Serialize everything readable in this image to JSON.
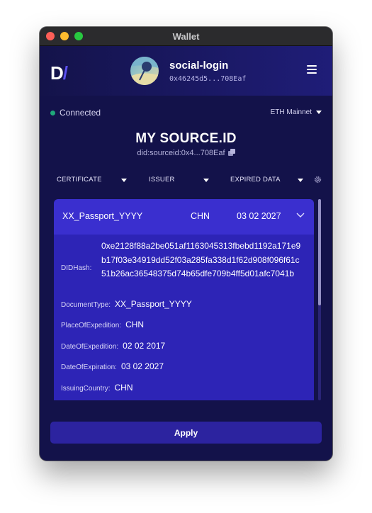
{
  "window": {
    "title": "Wallet"
  },
  "header": {
    "logo_text": "D",
    "account_name": "social-login",
    "account_address": "0x46245d5...708Eaf"
  },
  "status": {
    "connection": "Connected",
    "connection_color": "#1fa87a",
    "network": "ETH Mainnet"
  },
  "source": {
    "title": "MY SOURCE.ID",
    "did": "did:sourceid:0x4...708Eaf"
  },
  "filters": {
    "certificate": "CERTIFICATE",
    "issuer": "ISSUER",
    "expired": "EXPIRED DATA"
  },
  "card": {
    "name": "XX_Passport_YYYY",
    "country": "CHN",
    "expiry": "03 02 2027",
    "fields": {
      "did_hash_label": "DIDHash:",
      "did_hash_value": "0xe2128f88a2be051af1163045313fbebd1192a171e9b17f03e34919dd52f03a285fa338d1f62d908f096f61c51b26ac36548375d74b65dfe709b4ff5d01afc7041b",
      "document_type_label": "DocumentType:",
      "document_type_value": "XX_Passport_YYYY",
      "place_label": "PlaceOfExpedition:",
      "place_value": "CHN",
      "date_exp_label": "DateOfExpedition:",
      "date_exp_value": "02 02 2017",
      "date_expiration_label": "DateOfExpiration:",
      "date_expiration_value": "03 02 2027",
      "issuing_label": "IssuingCountry:",
      "issuing_value": "CHN"
    }
  },
  "actions": {
    "apply": "Apply"
  },
  "colors": {
    "window_bg": "#13124a",
    "card_header": "#3a2fcf",
    "card_body": "#2d24b6",
    "button": "#2c239f"
  }
}
